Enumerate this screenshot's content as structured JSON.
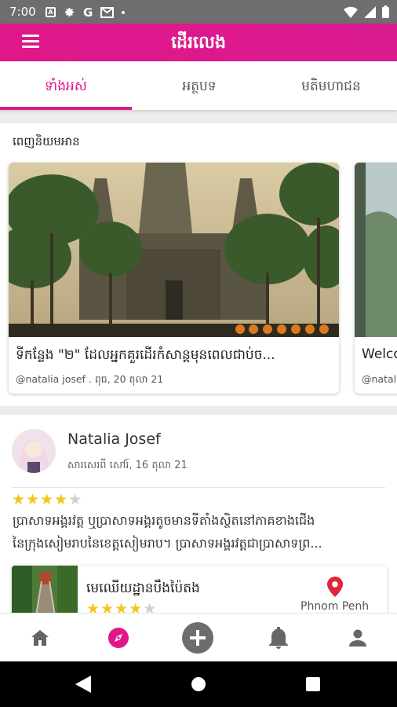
{
  "status_bar": {
    "time": "7:00",
    "icons": [
      "a-box-icon",
      "gear-icon",
      "google-g-icon",
      "gmail-icon",
      "dot-icon",
      "wifi-icon",
      "signal-icon",
      "battery-icon"
    ]
  },
  "app_bar": {
    "title": "ដើរលេង",
    "menu_icon": "hamburger-menu-icon"
  },
  "tabs": [
    {
      "label": "ទាំងអស់",
      "active": true
    },
    {
      "label": "អត្ថបទ",
      "active": false
    },
    {
      "label": "មតិមហាជន",
      "active": false
    }
  ],
  "recommended": {
    "title": "ពេញនិយមអាន",
    "cards": [
      {
        "title": "ទីកន្លែង \"២\" ដែលអ្នកគួរដើរកំសាន្តមុនពេលជាប់ច...",
        "meta": "@natalia josef . ពុធ, 20 តុលា 21"
      },
      {
        "title": "Welco",
        "meta": "@natal"
      }
    ]
  },
  "post": {
    "author": "Natalia Josef",
    "date": "សារសេរពី សៅរ៍, 16 តុលា 21",
    "rating": 4,
    "rating_max": 5,
    "body_lines": [
      "ប្រាសាទអង្គរវត្ត ឬប្រាសាទអង្គរតូចមានទីតាំងស្ថិតនៅភាគខាងជើង",
      "នៃក្រុងសៀមរាបនៃខេត្តសៀមរាប។ ប្រាសាទអង្គរវត្តជាប្រាសាទព្រ..."
    ],
    "place": {
      "name": "មេឈើយដ្ឋានបឹងប៉ៃតង",
      "rating": 4,
      "location": "Phnom Penh"
    }
  },
  "bottom_nav": [
    {
      "name": "home",
      "icon": "home-icon",
      "active": false
    },
    {
      "name": "explore",
      "icon": "compass-icon",
      "active": true
    },
    {
      "name": "add",
      "icon": "plus-circle-icon",
      "active": false
    },
    {
      "name": "notifications",
      "icon": "bell-icon",
      "active": false
    },
    {
      "name": "profile",
      "icon": "person-icon",
      "active": false
    }
  ],
  "colors": {
    "primary": "#e0178b",
    "star": "#f5c518",
    "pin": "#e0243b"
  }
}
